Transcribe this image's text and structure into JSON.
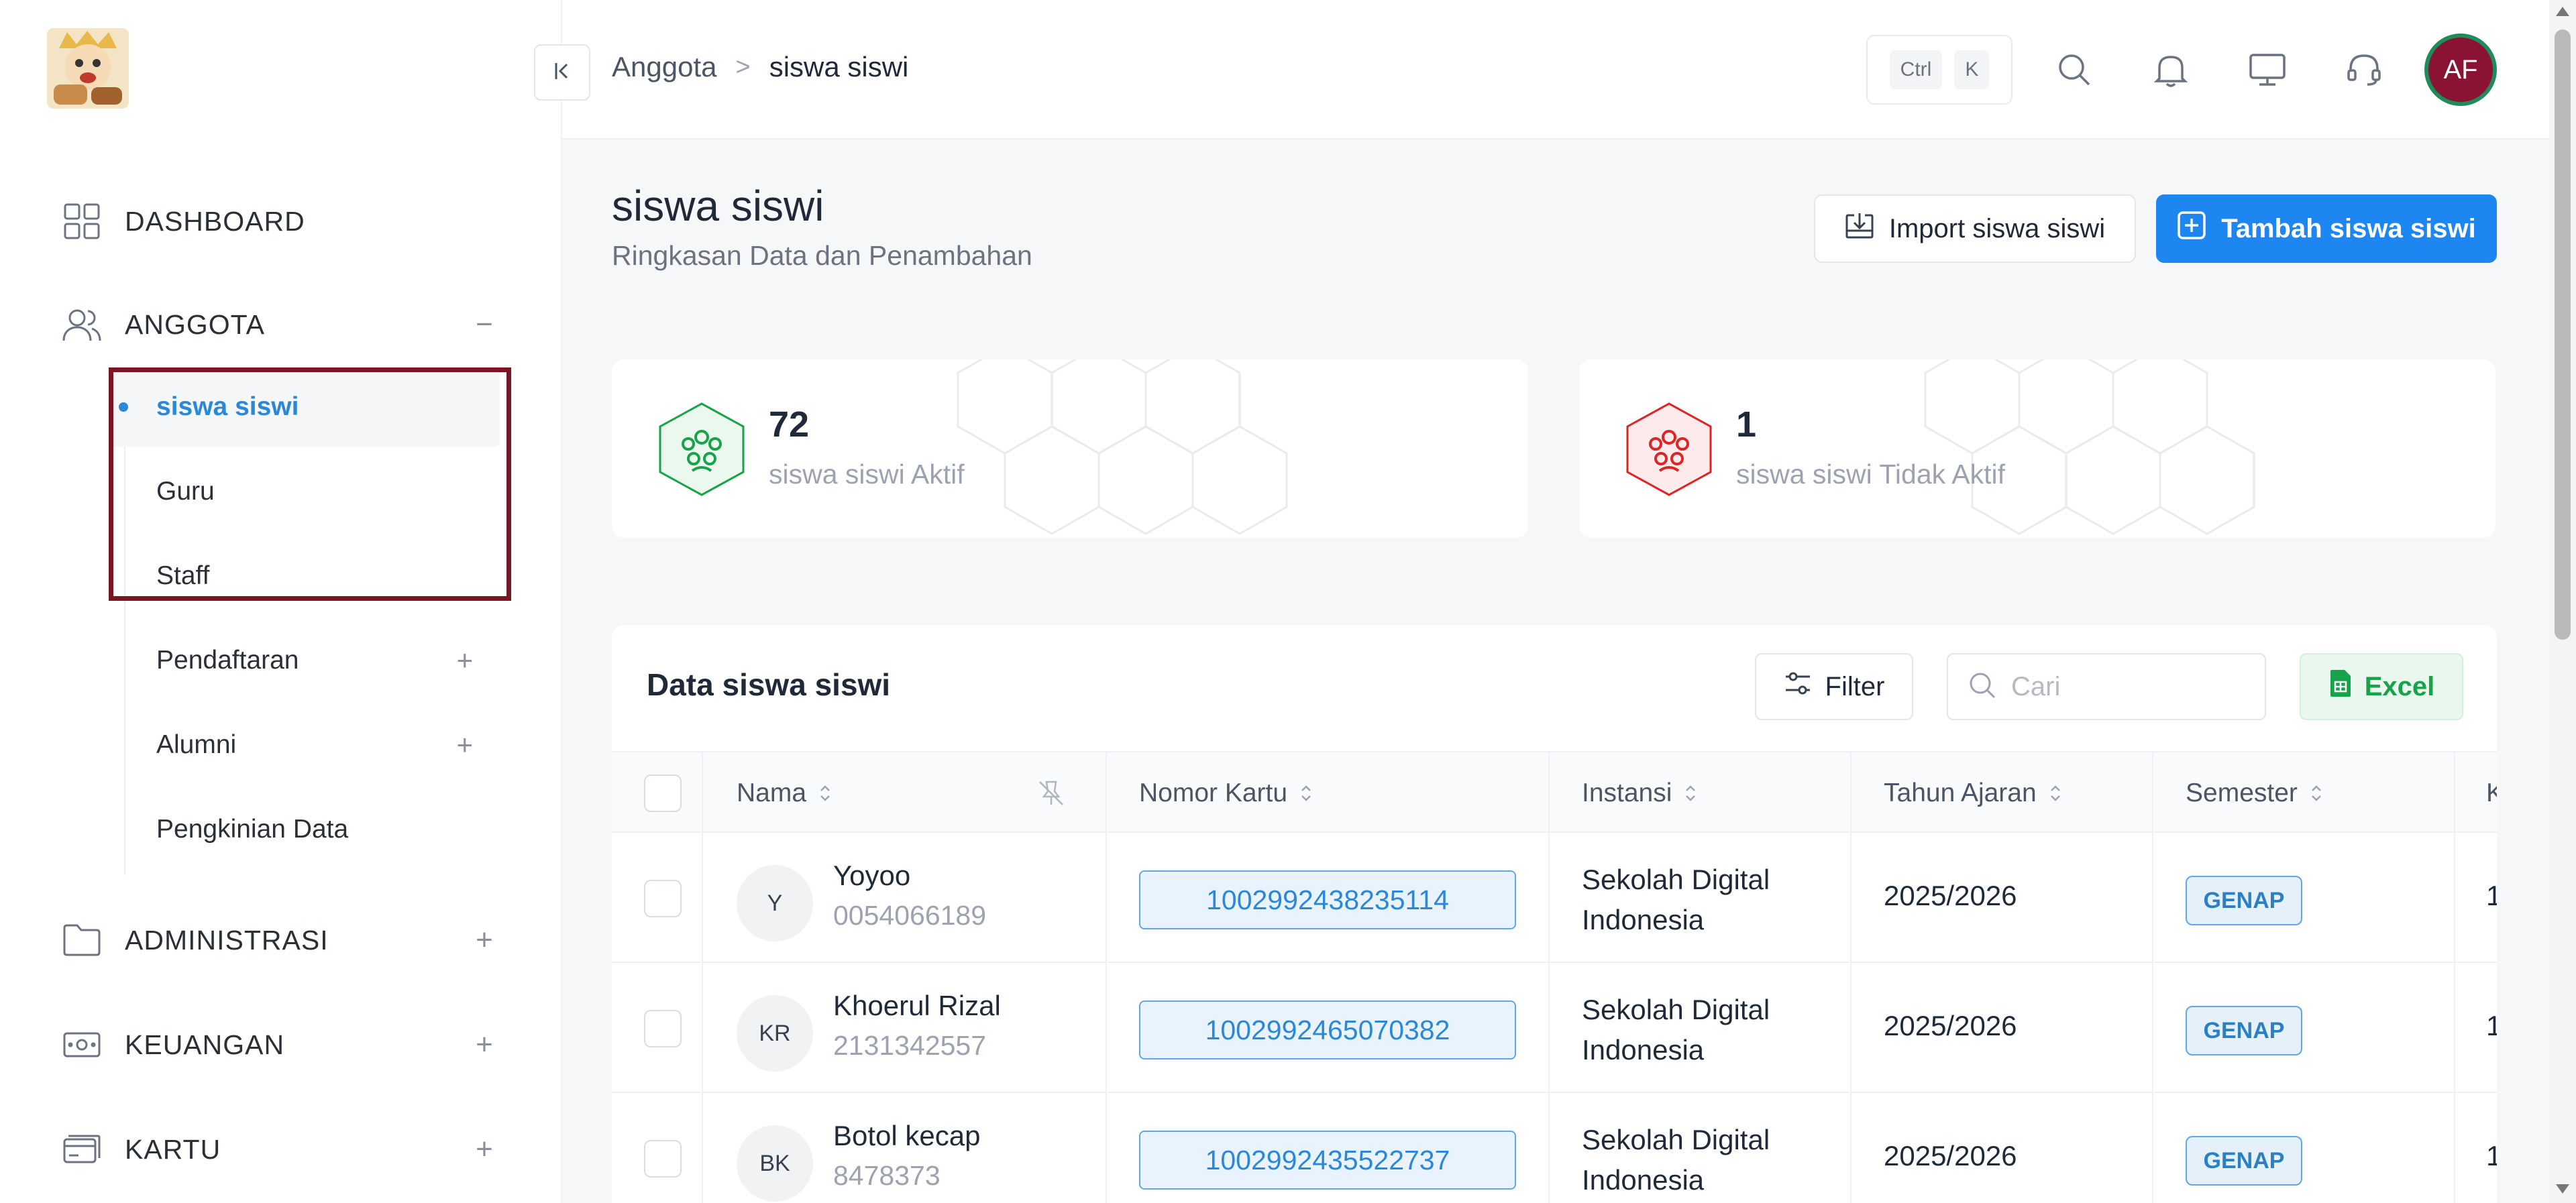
{
  "sidebar": {
    "logo_icon": "school-mascot-logo",
    "items": [
      {
        "label": "DASHBOARD",
        "icon": "grid-icon"
      },
      {
        "label": "ANGGOTA",
        "icon": "users-icon",
        "toggle": "−"
      },
      {
        "label": "ADMINISTRASI",
        "icon": "folder-icon",
        "toggle": "+"
      },
      {
        "label": "KEUANGAN",
        "icon": "money-icon",
        "toggle": "+"
      },
      {
        "label": "KARTU",
        "icon": "card-icon",
        "toggle": "+"
      }
    ],
    "subitems": [
      {
        "label": "siswa siswi",
        "active": true
      },
      {
        "label": "Guru"
      },
      {
        "label": "Staff"
      },
      {
        "label": "Pendaftaran",
        "toggle": "+"
      },
      {
        "label": "Alumni",
        "toggle": "+"
      },
      {
        "label": "Pengkinian Data"
      }
    ],
    "highlight_color": "#7a1624"
  },
  "header": {
    "breadcrumb": {
      "parent": "Anggota",
      "separator": ">",
      "current": "siswa siswi"
    },
    "shortcut": {
      "key1": "Ctrl",
      "key2": "K"
    },
    "avatar_initials": "AF",
    "avatar_color": "#8a1233"
  },
  "main": {
    "title": "siswa siswi",
    "subtitle": "Ringkasan Data dan Penambahan",
    "import_label": "Import siswa siswi",
    "add_label": "Tambah siswa siswi",
    "stats": [
      {
        "value": "72",
        "label": "siswa siswi Aktif",
        "color": "#16a34a"
      },
      {
        "value": "1",
        "label": "siswa siswi Tidak Aktif",
        "color": "#dc2626"
      }
    ]
  },
  "table": {
    "title": "Data siswa siswi",
    "filter_label": "Filter",
    "search_placeholder": "Cari",
    "excel_label": "Excel",
    "columns": [
      "Nama",
      "Nomor Kartu",
      "Instansi",
      "Tahun Ajaran",
      "Semester",
      "K"
    ],
    "rows": [
      {
        "initials": "Y",
        "name": "Yoyoo",
        "nis": "0054066189",
        "card": "1002992438235114",
        "instansi": "Sekolah Digital Indonesia",
        "tahun": "2025/2026",
        "semester": "GENAP",
        "k": "1"
      },
      {
        "initials": "KR",
        "name": "Khoerul Rizal",
        "nis": "2131342557",
        "card": "1002992465070382",
        "instansi": "Sekolah Digital Indonesia",
        "tahun": "2025/2026",
        "semester": "GENAP",
        "k": "1"
      },
      {
        "initials": "BK",
        "name": "Botol kecap",
        "nis": "8478373",
        "card": "1002992435522737",
        "instansi": "Sekolah Digital Indonesia",
        "tahun": "2025/2026",
        "semester": "GENAP",
        "k": "1"
      }
    ]
  }
}
